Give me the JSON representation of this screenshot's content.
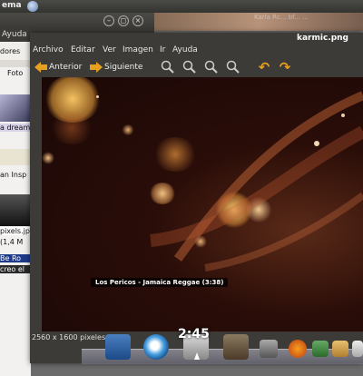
{
  "topbar": {
    "title": "ema"
  },
  "bg_window": {
    "menu_item": "Ayuda",
    "panel_label_1": "dores",
    "panel_label_2": "Foto",
    "panel_label_3": "a dream",
    "panel_label_4": "an Insp",
    "panel_label_5": "pixels.jp",
    "panel_label_6": "(1,4 M",
    "panel_label_7": "Be Ro",
    "panel_label_8": "creo el"
  },
  "bg_strip_text": "Karla Rc... bf... ...",
  "viewer": {
    "title": "karmic.png",
    "menu": {
      "archivo": "Archivo",
      "editar": "Editar",
      "ver": "Ver",
      "imagen": "Imagen",
      "ir": "Ir",
      "ayuda": "Ayuda"
    },
    "toolbar": {
      "prev": "Anterior",
      "next": "Siguiente"
    },
    "status": "2560 x 1600 pixeles  1,6"
  },
  "notification": "Los Pericos - Jamaica Reggae (3:38)",
  "dock": {
    "clock": "2:45"
  },
  "colors": {
    "accent": "#e6a020",
    "dark_chrome": "#3c3b37"
  }
}
